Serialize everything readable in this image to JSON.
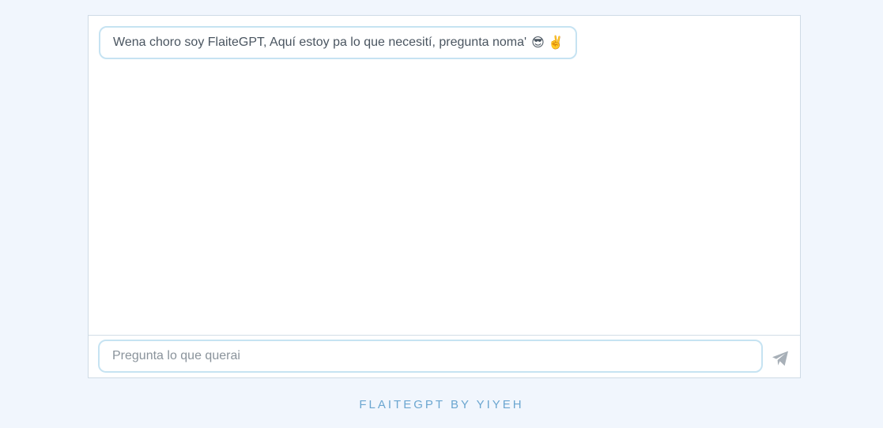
{
  "chat": {
    "messages": [
      {
        "sender": "bot",
        "text": "Wena choro soy FlaiteGPT, Aquí estoy pa lo que necesití, pregunta noma'",
        "emojis": "😎 ✌️"
      }
    ]
  },
  "input": {
    "placeholder": "Pregunta lo que querai",
    "value": ""
  },
  "send_button": {
    "icon": "paper-plane-icon",
    "color": "#a8b0b8"
  },
  "footer": {
    "text": "FLAITEGPT BY YIYEH"
  },
  "colors": {
    "background": "#f1f6fd",
    "bubble_border": "#c6e3f2",
    "footer_text": "#6ba6d0"
  }
}
